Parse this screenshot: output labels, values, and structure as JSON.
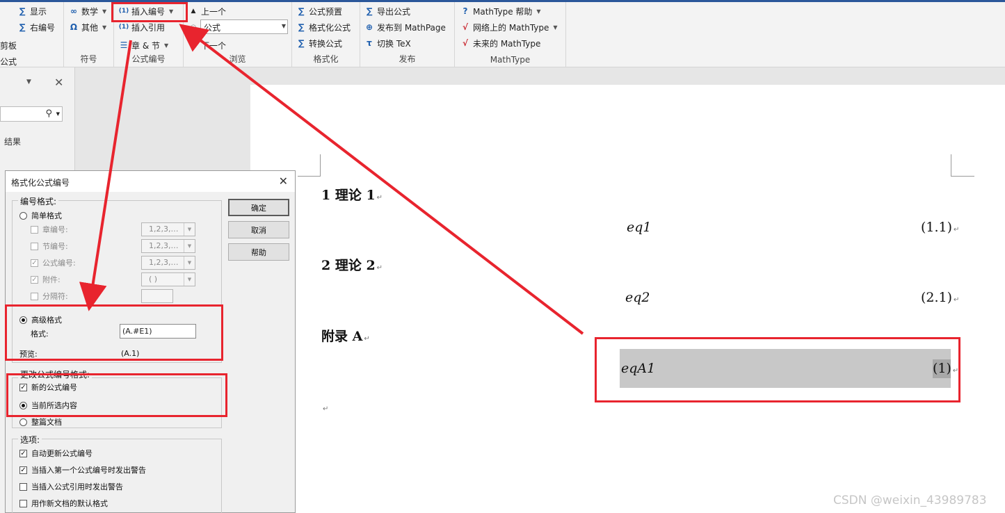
{
  "ribbon": {
    "group_partial": {
      "btn1": "显示",
      "btn2": "右编号",
      "frag1": "剪板",
      "frag2": "公式"
    },
    "symbols": {
      "btn1": "数学",
      "btn2": "其他",
      "label": "符号"
    },
    "numbering": {
      "btn1": "插入编号",
      "btn2": "插入引用",
      "btn3": "章 & 节",
      "label": "公式编号"
    },
    "browse": {
      "prev": "上一个",
      "combo": "公式",
      "next": "下一个",
      "label": "浏览"
    },
    "format": {
      "btn1": "公式预置",
      "btn2": "格式化公式",
      "btn3": "转换公式",
      "label": "格式化"
    },
    "publish": {
      "btn1": "导出公式",
      "btn2": "发布到 MathPage",
      "btn3": "切换 TeX",
      "label": "发布"
    },
    "mathtype": {
      "btn1": "MathType 帮助",
      "btn2": "网络上的 MathType",
      "btn3": "未来的 MathType",
      "label": "MathType"
    }
  },
  "nav": {
    "result": "结果"
  },
  "document": {
    "heading1": "1  理论 1",
    "eq1": "eq1",
    "eq1_num": "(1.1)",
    "heading2": "2  理论 2",
    "eq2": "eq2",
    "eq2_num": "(2.1)",
    "heading3": "附录 A",
    "eq3": "eqA1",
    "eq3_num": "(1)"
  },
  "dialog": {
    "title": "格式化公式编号",
    "group1": "编号格式:",
    "simple": "简单格式",
    "chapter": "章编号:",
    "section": "节编号:",
    "equation": "公式编号:",
    "enclosure": "附件:",
    "separator": "分隔符:",
    "sel_chapter": "1,2,3,…",
    "sel_section": "1,2,3,…",
    "sel_equation": "1,2,3,…",
    "sel_enclosure": "( )",
    "advanced": "高级格式",
    "format_label": "格式:",
    "format_value": "(A.#E1)",
    "preview_label": "预览:",
    "preview_value": "(A.1)",
    "group2": "更改公式编号格式:",
    "new_numbers": "新的公式编号",
    "current_sel": "当前所选内容",
    "whole_doc": "整篇文档",
    "group3": "选项:",
    "opt1": "自动更新公式编号",
    "opt2": "当插入第一个公式编号时发出警告",
    "opt3": "当插入公式引用时发出警告",
    "opt4": "用作新文档的默认格式",
    "ok": "确定",
    "cancel": "取消",
    "help": "帮助"
  },
  "watermark": "CSDN @weixin_43989783",
  "colors": {
    "annotation": "#e8242e",
    "ribbon_accent": "#2b579a",
    "highlight": "#c8c8c8"
  }
}
